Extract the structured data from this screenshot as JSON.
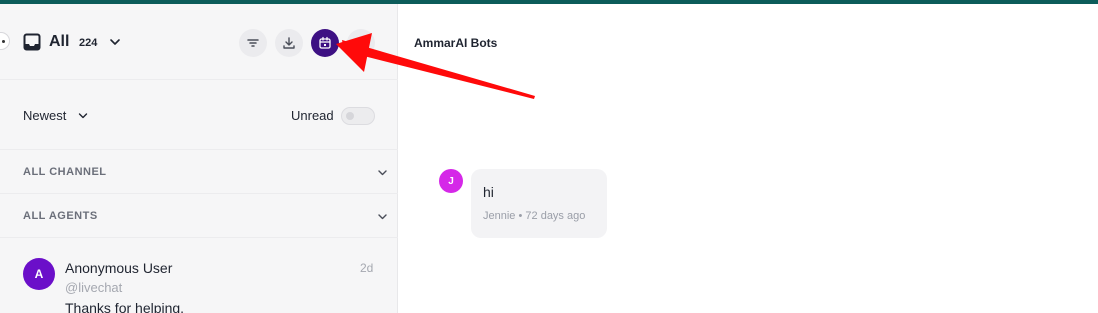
{
  "colors": {
    "accent_bar": "#0c5c5a",
    "calendar_button": "#3d1083",
    "anonymous_avatar": "#6b0fc9",
    "message_avatar": "#d528e8",
    "annotation_arrow": "#ff0a0a"
  },
  "inbox": {
    "label": "All",
    "count": "224",
    "icon": "inbox-tray-icon"
  },
  "toolbar": {
    "icons": [
      "filter-icon",
      "download-icon",
      "calendar-icon",
      "search-icon"
    ]
  },
  "sort": {
    "label": "Newest",
    "unread_label": "Unread",
    "unread_enabled": false
  },
  "filters": {
    "channel_label": "ALL CHANNEL",
    "agents_label": "ALL AGENTS"
  },
  "conversation": {
    "avatar_initial": "A",
    "name": "Anonymous User",
    "time": "2d",
    "handle": "@livechat",
    "preview": "Thanks for helping."
  },
  "chat": {
    "title": "AmmarAI Bots",
    "message": {
      "avatar_initial": "J",
      "text": "hi",
      "author": "Jennie",
      "separator": "•",
      "time": "72 days ago"
    }
  }
}
